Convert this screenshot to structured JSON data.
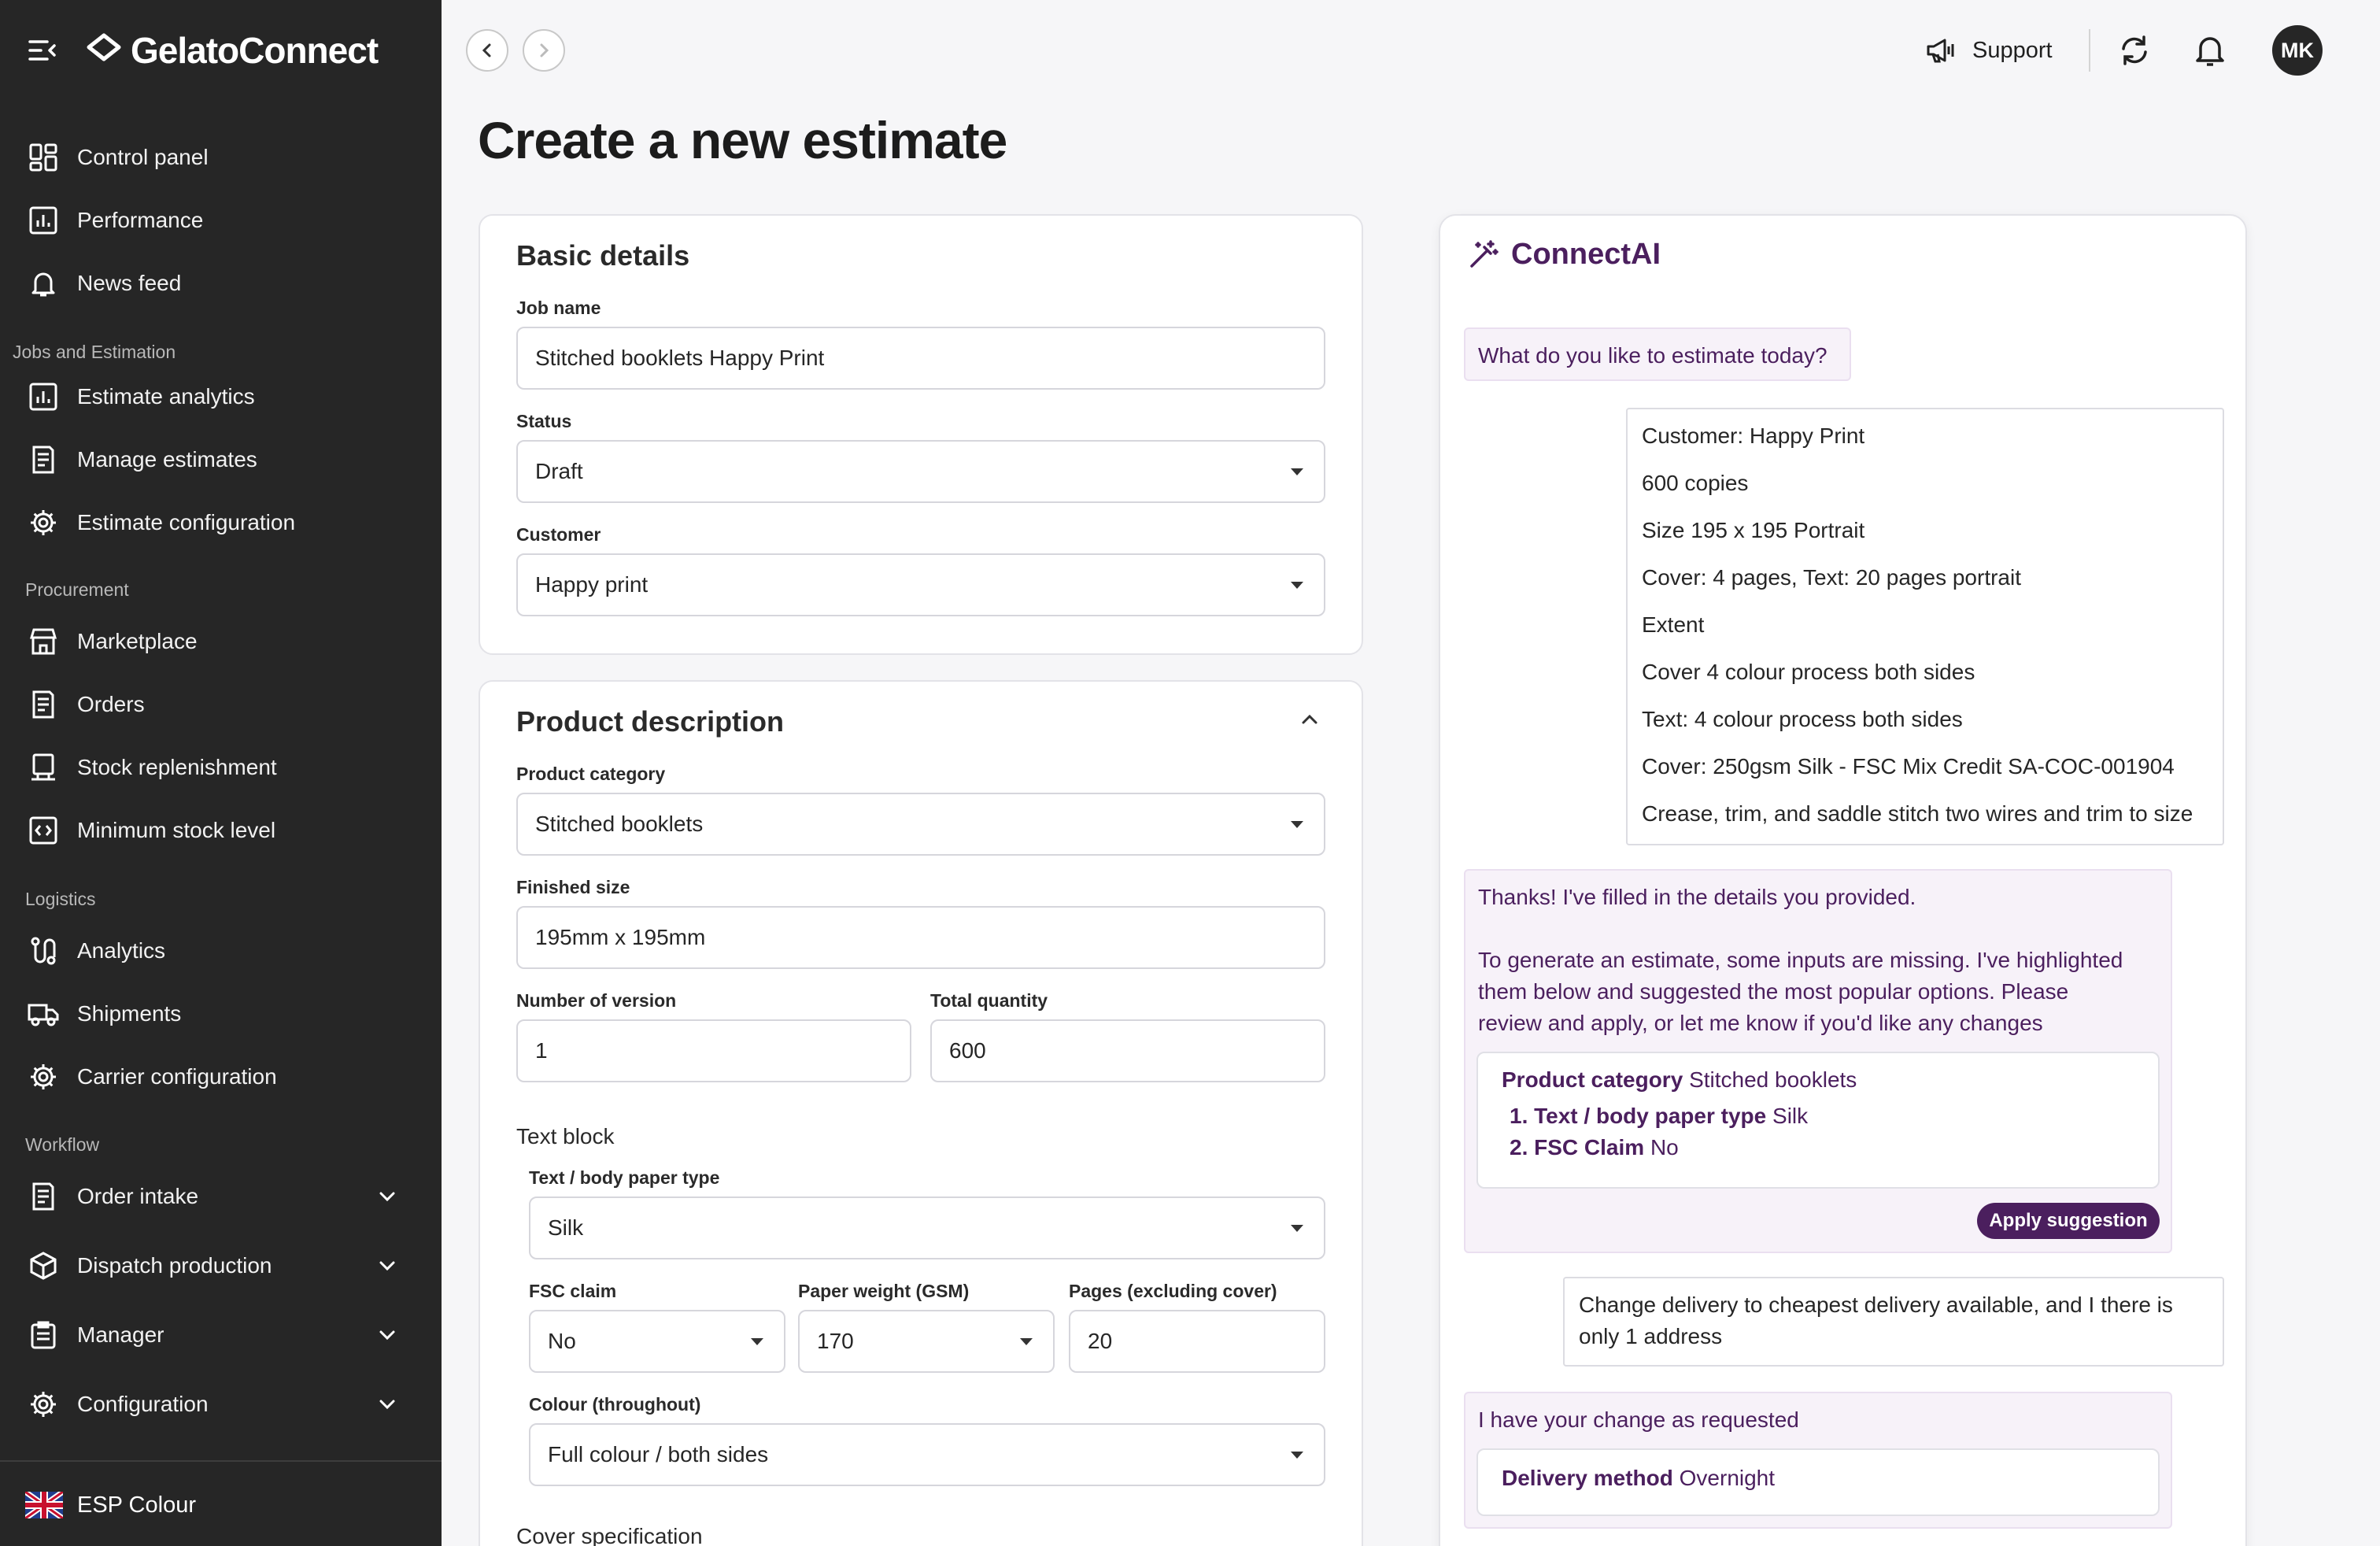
{
  "brand": {
    "name": "GelatoConnect"
  },
  "sidebar": {
    "items": [
      {
        "label": "Control panel",
        "icon": "grid-icon"
      },
      {
        "label": "Performance",
        "icon": "chart-icon"
      },
      {
        "label": "News feed",
        "icon": "bell-icon"
      }
    ],
    "sections": {
      "jobs": "Jobs and Estimation",
      "procurement": "Procurement",
      "logistics": "Logistics",
      "workflow": "Workflow"
    },
    "jobs_items": [
      {
        "label": "Estimate analytics"
      },
      {
        "label": "Manage estimates"
      },
      {
        "label": "Estimate configuration"
      }
    ],
    "procurement_items": [
      {
        "label": "Marketplace"
      },
      {
        "label": "Orders"
      },
      {
        "label": "Stock replenishment"
      },
      {
        "label": "Minimum stock level"
      }
    ],
    "logistics_items": [
      {
        "label": "Analytics"
      },
      {
        "label": "Shipments"
      },
      {
        "label": "Carrier configuration"
      }
    ],
    "workflow_items": [
      {
        "label": "Order intake"
      },
      {
        "label": "Dispatch production"
      },
      {
        "label": "Manager"
      },
      {
        "label": "Configuration"
      }
    ],
    "language": "ESP Colour"
  },
  "topbar": {
    "support_label": "Support",
    "avatar_initials": "MK"
  },
  "page": {
    "title": "Create a new estimate"
  },
  "basic": {
    "title": "Basic details",
    "job_name_label": "Job name",
    "job_name": "Stitched booklets Happy Print",
    "status_label": "Status",
    "status": "Draft",
    "customer_label": "Customer",
    "customer": "Happy print"
  },
  "product": {
    "title": "Product description",
    "category_label": "Product category",
    "category": "Stitched booklets",
    "size_label": "Finished size",
    "size": "195mm x 195mm",
    "versions_label": "Number of version",
    "versions": "1",
    "quantity_label": "Total quantity",
    "quantity": "600",
    "text_block_label": "Text block",
    "paper_type_label": "Text / body paper type",
    "paper_type": "Silk",
    "fsc_label": "FSC claim",
    "fsc": "No",
    "weight_label": "Paper weight (GSM)",
    "weight": "170",
    "pages_label": "Pages (excluding cover)",
    "pages": "20",
    "colour_label": "Colour (throughout)",
    "colour": "Full colour / both sides",
    "cover_label": "Cover specification"
  },
  "ai": {
    "title": "ConnectAI",
    "greeting": "What do you like to estimate today?",
    "user_message_lines": [
      "Customer: Happy Print",
      "600 copies",
      "Size 195 x 195 Portrait",
      "Cover: 4 pages, Text: 20 pages portrait",
      "Extent",
      "Cover 4 colour process both sides",
      "Text: 4 colour process both sides",
      "Cover: 250gsm Silk - FSC Mix Credit SA-COC-001904",
      "Crease, trim, and saddle stitch two wires and trim to size"
    ],
    "reply_1": "Thanks! I've filled in the details you provided.",
    "reply_2_lines": [
      "To generate an estimate, some inputs are missing. I've highlighted",
      "them below and suggested the most popular options. Please",
      "review and apply, or let me know if you'd like any changes"
    ],
    "suggestion": {
      "category_key": "Product category",
      "category_value": "Stitched booklets",
      "item1_num": "1.",
      "item1_key": "Text / body paper type",
      "item1_value": "Silk",
      "item2_num": "2.",
      "item2_key": "FSC Claim",
      "item2_value": "No"
    },
    "apply_label": "Apply suggestion",
    "user_message_2_lines": [
      "Change delivery to cheapest delivery available, and I there is",
      "only 1 address"
    ],
    "reply_3": "I have your change as requested",
    "delivery_key": "Delivery method",
    "delivery_value": "Overnight"
  },
  "colors": {
    "sidebar_bg": "#262626",
    "accent": "#4b1f5e",
    "ai_bubble_bg": "#f7f2f9"
  }
}
